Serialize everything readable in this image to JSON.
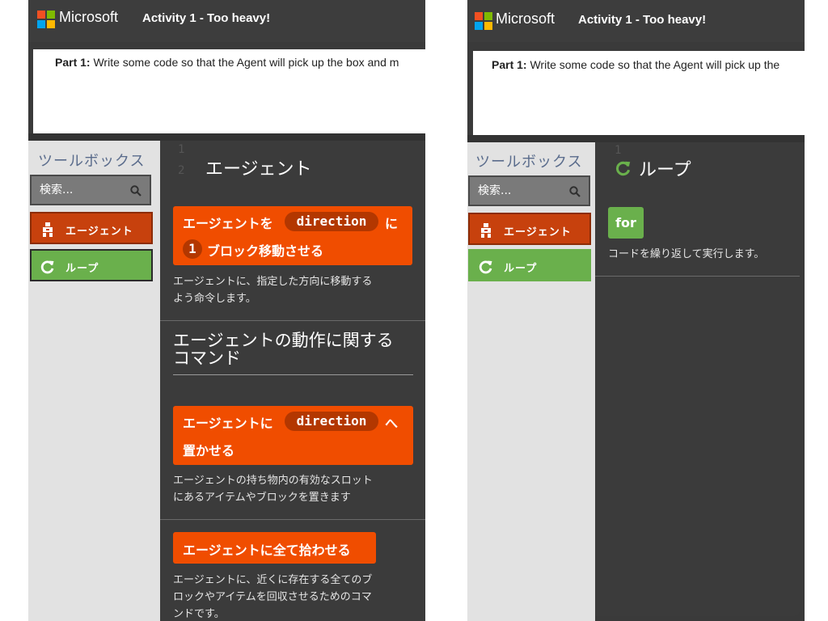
{
  "header": {
    "brand": "Microsoft",
    "activity_title": "Activity 1 - Too heavy!"
  },
  "instructions": {
    "left": {
      "bold": "Part 1:",
      "text": " Write some code so that the Agent will pick up the box and m"
    },
    "right": {
      "bold": "Part 1:",
      "text": " Write some code so that the Agent will pick up the"
    }
  },
  "toolbox": {
    "title": "ツールボックス",
    "search_placeholder": "検索...",
    "categories": [
      {
        "label": "エージェント",
        "icon": "agent-icon",
        "color": "#c7410d"
      },
      {
        "label": "ループ",
        "icon": "loop-icon",
        "color": "#6ab04c"
      }
    ]
  },
  "agent_flyout": {
    "line_numbers": [
      "1",
      "2"
    ],
    "title": "エージェント",
    "move_block": {
      "prefix": "エージェントを",
      "direction": "direction",
      "particle": "に",
      "count": "1",
      "suffix": "ブロック移動させる"
    },
    "move_desc": [
      "エージェントに、指定した方向に移動する",
      "よう命令します。"
    ],
    "section_title": [
      "エージェントの動作に関する",
      "コマンド"
    ],
    "place_block": {
      "prefix": "エージェントに",
      "direction": "direction",
      "particle": "へ",
      "suffix": "置かせる"
    },
    "place_desc": [
      "エージェントの持ち物内の有効なスロット",
      "にあるアイテムやブロックを置きます"
    ],
    "collect_block": "エージェントに全て拾わせる",
    "collect_desc": [
      "エージェントに、近くに存在する全てのブ",
      "ロックやアイテムを回収させるためのコマ",
      "ンドです。"
    ]
  },
  "loop_flyout": {
    "line_number": "1",
    "title": "ループ",
    "for_block": "for",
    "for_desc": "コードを繰り返して実行します。"
  },
  "colors": {
    "agent": "#f04d00",
    "agent_dark": "#b33700",
    "loop": "#6ab04c",
    "toolbox_title": "#5a6c8c"
  }
}
